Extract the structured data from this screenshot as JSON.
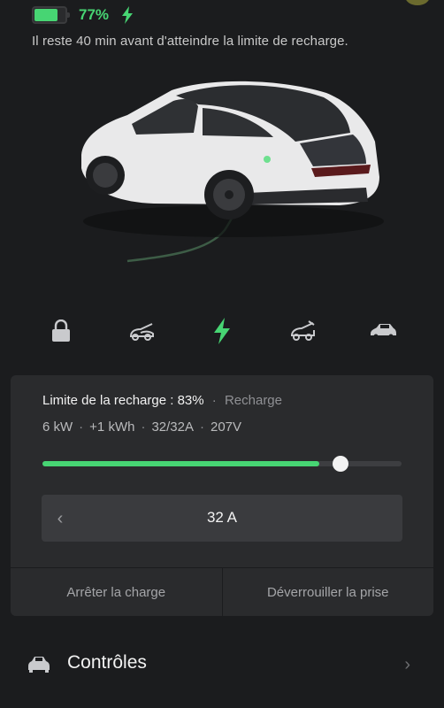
{
  "status": {
    "battery_percent_text": "77%",
    "battery_level": 0.77,
    "charging_icon": "lightning-bolt-icon",
    "remaining_text": "Il reste 40 min avant d'atteindre la limite de recharge."
  },
  "quick_actions": [
    {
      "name": "lock-icon"
    },
    {
      "name": "frunk-icon"
    },
    {
      "name": "charge-icon"
    },
    {
      "name": "trunk-icon"
    },
    {
      "name": "vent-icon"
    }
  ],
  "charging_panel": {
    "limit_label": "Limite de la recharge : 83%",
    "dot": "·",
    "state_label": "Recharge",
    "stats": [
      "6 kW",
      "+1 kWh",
      "32/32A",
      "207V"
    ],
    "stats_separator": "·",
    "current_level": 0.77,
    "limit_level": 0.83,
    "amp_prev_symbol": "‹",
    "amp_value": "32 A",
    "stop_button": "Arrêter la charge",
    "unlock_port_button": "Déverrouiller la prise"
  },
  "menu": {
    "controls_label": "Contrôles",
    "chevron": "›"
  },
  "colors": {
    "background": "#1b1c1e",
    "panel": "#2a2b2d",
    "accent_green": "#47d573"
  }
}
